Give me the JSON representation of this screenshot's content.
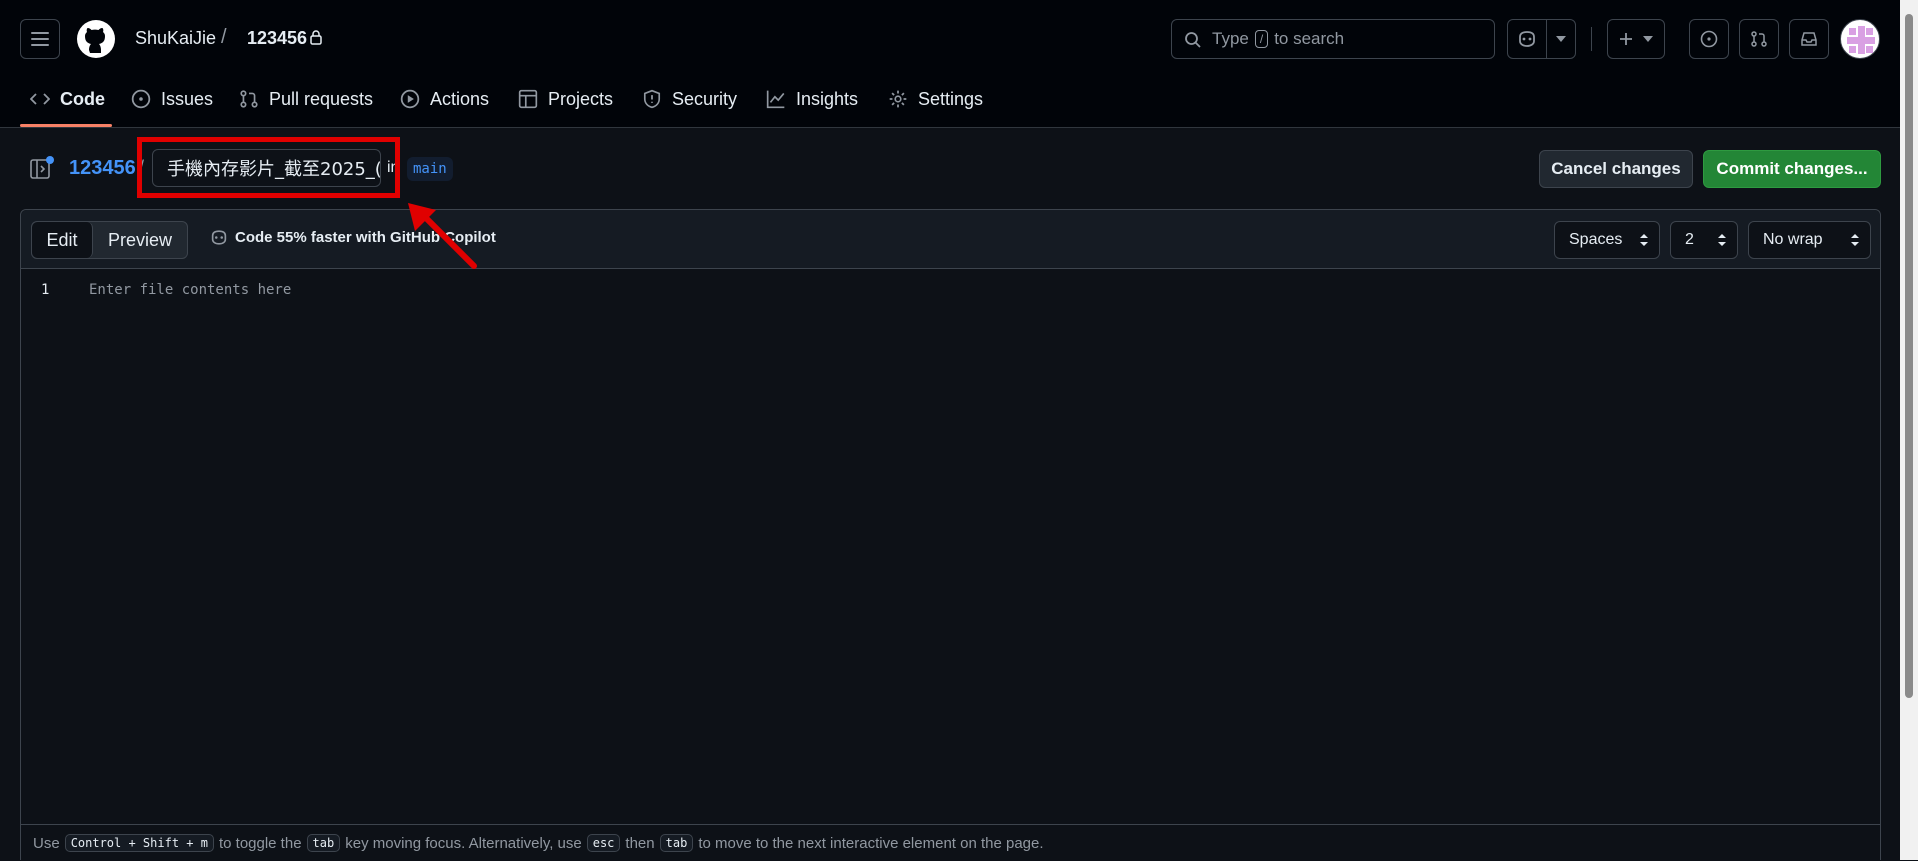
{
  "header": {
    "owner": "ShuKaiJie",
    "separator": "/",
    "repo": "123456",
    "search_prefix": "Type",
    "search_key": "/",
    "search_suffix": "to search"
  },
  "tabs": [
    {
      "label": "Code"
    },
    {
      "label": "Issues"
    },
    {
      "label": "Pull requests"
    },
    {
      "label": "Actions"
    },
    {
      "label": "Projects"
    },
    {
      "label": "Security"
    },
    {
      "label": "Insights"
    },
    {
      "label": "Settings"
    }
  ],
  "breadcrumb": {
    "repo": "123456",
    "slash": "/",
    "filename_value": "手機內存影片_截至2025_(",
    "in_text": "in",
    "branch": "main"
  },
  "actions": {
    "cancel": "Cancel changes",
    "commit": "Commit changes..."
  },
  "editor": {
    "edit_tab": "Edit",
    "preview_tab": "Preview",
    "copilot_text": "Code 55% faster with GitHub Copilot",
    "indent_mode": "Spaces",
    "indent_size": "2",
    "wrap_mode": "No wrap",
    "line_number": "1",
    "placeholder": "Enter file contents here"
  },
  "footer": {
    "t1": "Use",
    "k1": "Control + Shift + m",
    "t2": "to toggle the",
    "k2": "tab",
    "t3": "key moving focus. Alternatively, use",
    "k3": "esc",
    "t4": "then",
    "k4": "tab",
    "t5": "to move to the next interactive element on the page."
  },
  "colors": {
    "accent_link": "#4493f8",
    "commit_green": "#238636",
    "tab_underline": "#f78166",
    "annotation_red": "#e00000"
  }
}
